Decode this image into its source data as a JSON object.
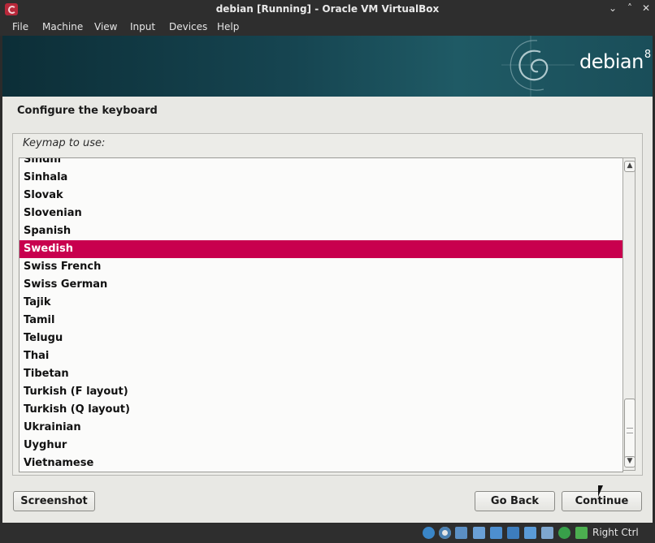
{
  "window": {
    "title": "debian [Running] - Oracle VM VirtualBox",
    "controls": [
      "⌄",
      "˄",
      "✕"
    ]
  },
  "menubar": {
    "items": [
      "File",
      "Machine",
      "View",
      "Input",
      "Devices",
      "Help"
    ]
  },
  "banner": {
    "brand": "debian",
    "version": "8"
  },
  "installer": {
    "heading": "Configure the keyboard",
    "field_label": "Keymap to use:",
    "keymaps": [
      "Sindhi",
      "Sinhala",
      "Slovak",
      "Slovenian",
      "Spanish",
      "Swedish",
      "Swiss French",
      "Swiss German",
      "Tajik",
      "Tamil",
      "Telugu",
      "Thai",
      "Tibetan",
      "Turkish (F layout)",
      "Turkish (Q layout)",
      "Ukrainian",
      "Uyghur",
      "Vietnamese"
    ],
    "selected": "Swedish",
    "scroll_position": 0.97
  },
  "buttons": {
    "screenshot": "Screenshot",
    "go_back": "Go Back",
    "continue": "Continue"
  },
  "statusbar": {
    "host_key": "Right Ctrl"
  },
  "colors": {
    "selection": "#c8004e",
    "banner": "#164551"
  }
}
